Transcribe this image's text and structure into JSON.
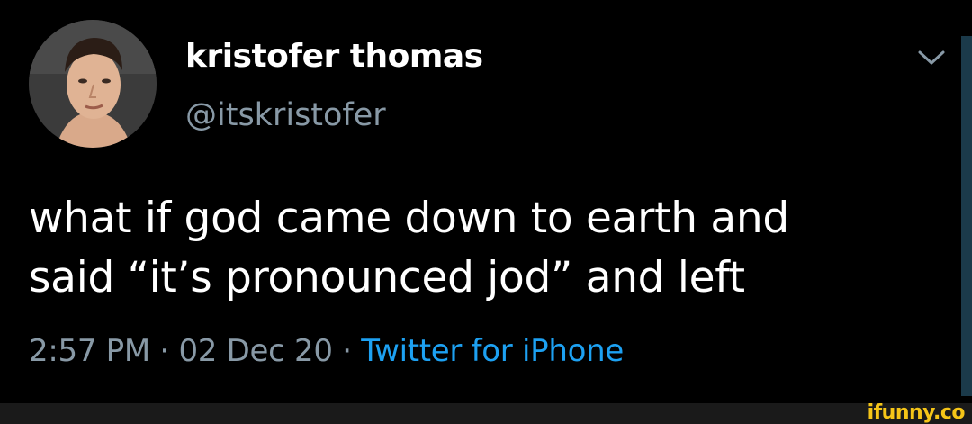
{
  "tweet": {
    "display_name": "kristofer thomas",
    "handle": "@itskristofer",
    "text_line_1": "what if god came down to earth and",
    "text_line_2": "said “it’s pronounced jod” and left",
    "time": "2:57 PM",
    "separator": "·",
    "date": "02 Dec 20",
    "source": "Twitter for iPhone"
  },
  "watermark": {
    "text": "ifunny.co"
  },
  "icons": {
    "menu": "chevron-down-icon",
    "avatar": "profile-photo"
  },
  "colors": {
    "background": "#000000",
    "primary_text": "#ffffff",
    "secondary_text": "#8899a6",
    "link": "#1da1f2",
    "watermark": "#f5c518"
  }
}
